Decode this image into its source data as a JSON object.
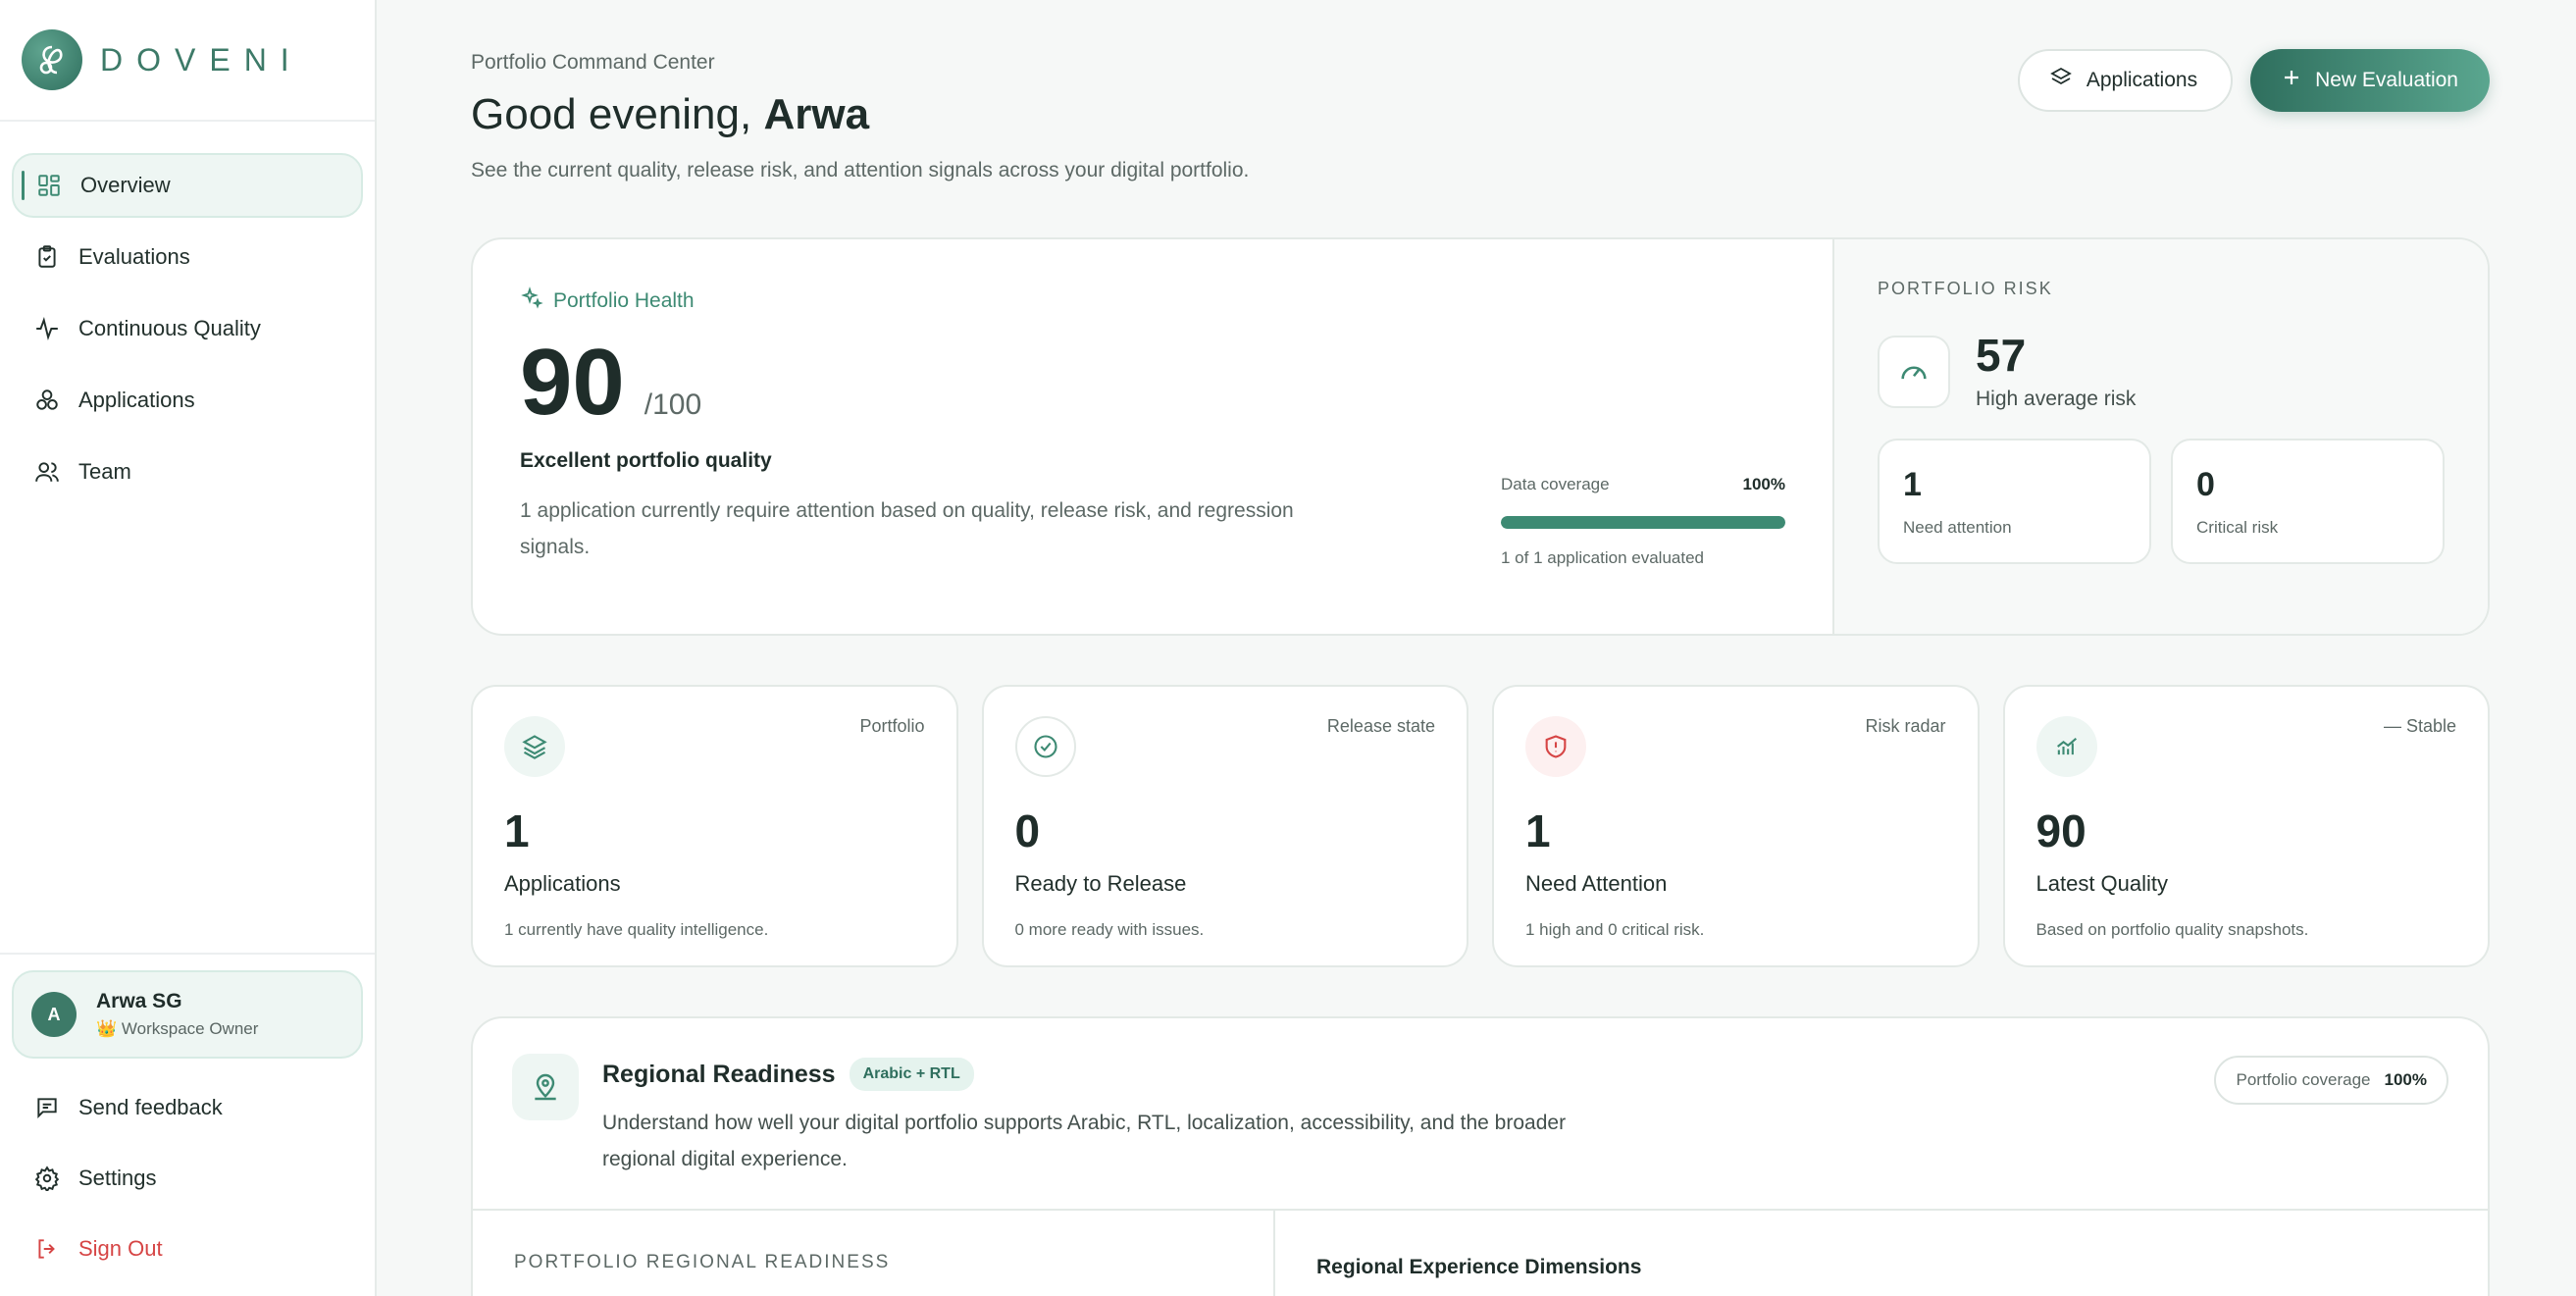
{
  "brand": {
    "name": "DOVENI"
  },
  "nav": {
    "items": [
      {
        "label": "Overview",
        "icon": "grid-icon"
      },
      {
        "label": "Evaluations",
        "icon": "clipboard-icon"
      },
      {
        "label": "Continuous Quality",
        "icon": "activity-icon"
      },
      {
        "label": "Applications",
        "icon": "apps-icon"
      },
      {
        "label": "Team",
        "icon": "users-icon"
      }
    ]
  },
  "user": {
    "initial": "A",
    "name": "Arwa SG",
    "role": "👑 Workspace Owner"
  },
  "bottom_nav": {
    "feedback": "Send feedback",
    "settings": "Settings",
    "signout": "Sign Out"
  },
  "header": {
    "eyebrow": "Portfolio Command Center",
    "greeting": "Good evening,",
    "name": "Arwa",
    "subtitle": "See the current quality, release risk, and attention signals across your digital portfolio.",
    "applications_button": "Applications",
    "new_eval_button": "New Evaluation"
  },
  "health": {
    "tag": "Portfolio Health",
    "score": "90",
    "score_max": "/100",
    "quality_label": "Excellent portfolio quality",
    "description": "1 application currently require attention based on quality, release risk, and regression signals.",
    "coverage_label": "Data coverage",
    "coverage_value": "100%",
    "coverage_fraction": 1.0,
    "coverage_foot": "1 of 1 application evaluated"
  },
  "risk": {
    "eyebrow": "PORTFOLIO RISK",
    "score": "57",
    "label": "High average risk",
    "boxes": [
      {
        "value": "1",
        "label": "Need attention"
      },
      {
        "value": "0",
        "label": "Critical risk"
      }
    ]
  },
  "stats": [
    {
      "tag": "Portfolio",
      "value": "1",
      "label": "Applications",
      "desc": "1 currently have quality intelligence."
    },
    {
      "tag": "Release state",
      "value": "0",
      "label": "Ready to Release",
      "desc": "0 more ready with issues."
    },
    {
      "tag": "Risk radar",
      "value": "1",
      "label": "Need Attention",
      "desc": "1 high and 0 critical risk."
    },
    {
      "tag": "— Stable",
      "value": "90",
      "label": "Latest Quality",
      "desc": "Based on portfolio quality snapshots."
    }
  ],
  "regional": {
    "title": "Regional Readiness",
    "pill": "Arabic + RTL",
    "description": "Understand how well your digital portfolio supports Arabic, RTL, localization, accessibility, and the broader regional digital experience.",
    "coverage_label": "Portfolio coverage",
    "coverage_value": "100%",
    "left_heading": "PORTFOLIO REGIONAL READINESS",
    "right_heading": "Regional Experience Dimensions"
  },
  "colors": {
    "accent": "#3d8a73",
    "accent_dark": "#2f6f5e",
    "danger": "#d64545"
  }
}
